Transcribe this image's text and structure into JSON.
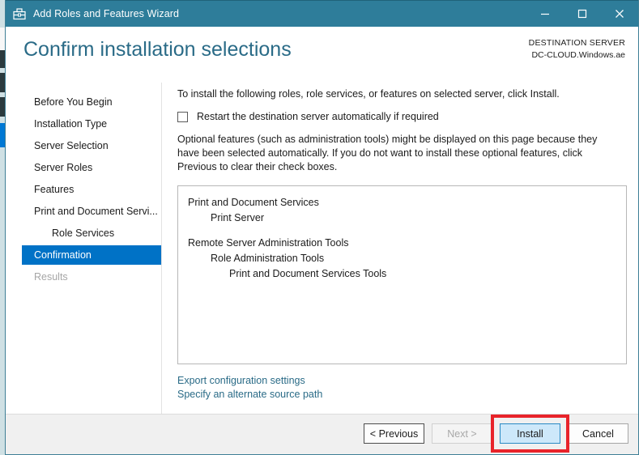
{
  "window": {
    "title": "Add Roles and Features Wizard",
    "icon": "wizard-toolbox-icon",
    "controls": {
      "minimize": "minimize-icon",
      "maximize": "maximize-icon",
      "close": "close-icon"
    },
    "titlebar_color": "#2e7d9a"
  },
  "header": {
    "page_title": "Confirm installation selections",
    "destination_label": "DESTINATION SERVER",
    "destination_server": "DC-CLOUD.Windows.ae",
    "title_color": "#2a6b87"
  },
  "sidebar": {
    "items": [
      {
        "label": "Before You Begin",
        "state": "normal",
        "indent": 0
      },
      {
        "label": "Installation Type",
        "state": "normal",
        "indent": 0
      },
      {
        "label": "Server Selection",
        "state": "normal",
        "indent": 0
      },
      {
        "label": "Server Roles",
        "state": "normal",
        "indent": 0
      },
      {
        "label": "Features",
        "state": "normal",
        "indent": 0
      },
      {
        "label": "Print and Document Servi...",
        "state": "normal",
        "indent": 0
      },
      {
        "label": "Role Services",
        "state": "normal",
        "indent": 1
      },
      {
        "label": "Confirmation",
        "state": "selected",
        "indent": 0
      },
      {
        "label": "Results",
        "state": "disabled",
        "indent": 0
      }
    ],
    "selected_color": "#0072c6"
  },
  "content": {
    "intro_text": "To install the following roles, role services, or features on selected server, click Install.",
    "restart_checkbox_label": "Restart the destination server automatically if required",
    "restart_checkbox_checked": false,
    "optional_text": "Optional features (such as administration tools) might be displayed on this page because they have been selected automatically. If you do not want to install these optional features, click Previous to clear their check boxes.",
    "selections": [
      {
        "label": "Print and Document Services",
        "level": 0,
        "gap_before": false
      },
      {
        "label": "Print Server",
        "level": 1,
        "gap_before": false
      },
      {
        "label": "Remote Server Administration Tools",
        "level": 0,
        "gap_before": true
      },
      {
        "label": "Role Administration Tools",
        "level": 1,
        "gap_before": false
      },
      {
        "label": "Print and Document Services Tools",
        "level": 2,
        "gap_before": false
      }
    ],
    "links": [
      {
        "label": "Export configuration settings"
      },
      {
        "label": "Specify an alternate source path"
      }
    ],
    "link_color": "#2a6b87"
  },
  "footer": {
    "buttons": [
      {
        "label": "< Previous",
        "style": "default"
      },
      {
        "label": "Next >",
        "style": "disabled"
      },
      {
        "label": "Install",
        "style": "primary",
        "highlighted": true
      },
      {
        "label": "Cancel",
        "style": "normal"
      }
    ],
    "highlight_color": "#e8232a",
    "primary_fill": "#cde8fa"
  }
}
